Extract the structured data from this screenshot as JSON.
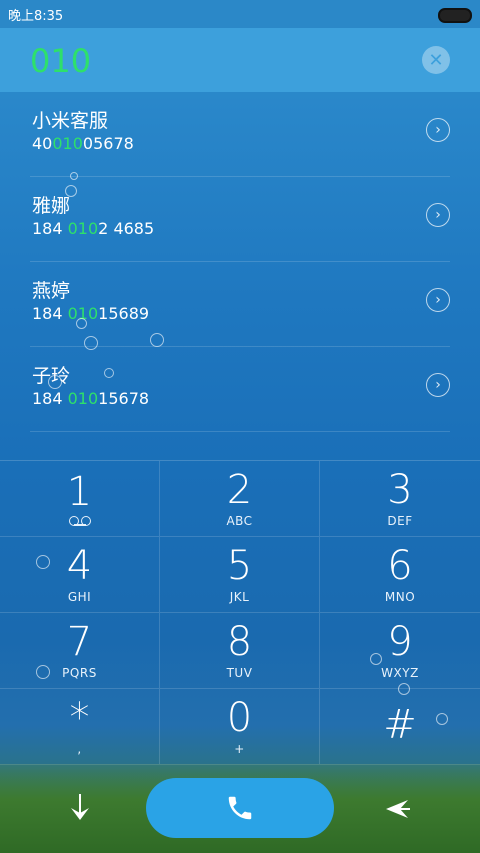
{
  "status_bar": {
    "time": "晚上8:35"
  },
  "header": {
    "dialed": "010"
  },
  "contacts": [
    {
      "name": "小米客服",
      "num_pre": "40",
      "num_hl": "010",
      "num_post": "05678"
    },
    {
      "name": "雅娜",
      "num_pre": "184 ",
      "num_hl": "010",
      "num_post": "2 4685"
    },
    {
      "name": "燕婷",
      "num_pre": "184 ",
      "num_hl": "010",
      "num_post": "15689"
    },
    {
      "name": "子玲",
      "num_pre": "184 ",
      "num_hl": "010",
      "num_post": "15678"
    }
  ],
  "keypad": [
    {
      "digit": "1",
      "letters": ""
    },
    {
      "digit": "2",
      "letters": "ABC"
    },
    {
      "digit": "3",
      "letters": "DEF"
    },
    {
      "digit": "4",
      "letters": "GHI"
    },
    {
      "digit": "5",
      "letters": "JKL"
    },
    {
      "digit": "6",
      "letters": "MNO"
    },
    {
      "digit": "7",
      "letters": "PQRS"
    },
    {
      "digit": "8",
      "letters": "TUV"
    },
    {
      "digit": "9",
      "letters": "WXYZ"
    },
    {
      "digit": "*",
      "letters": ","
    },
    {
      "digit": "0",
      "letters": "+"
    },
    {
      "digit": "#",
      "letters": ""
    }
  ],
  "icons": {
    "clear": "close-icon",
    "contact_detail": "chevron-right-icon",
    "voicemail": "voicemail-icon",
    "hide_keypad": "arrow-down-icon",
    "call": "phone-icon",
    "back": "backspace-icon"
  },
  "colors": {
    "accent_green": "#2ee06b",
    "call_button": "#2aa3e6",
    "header_bg": "#3da0dc"
  }
}
